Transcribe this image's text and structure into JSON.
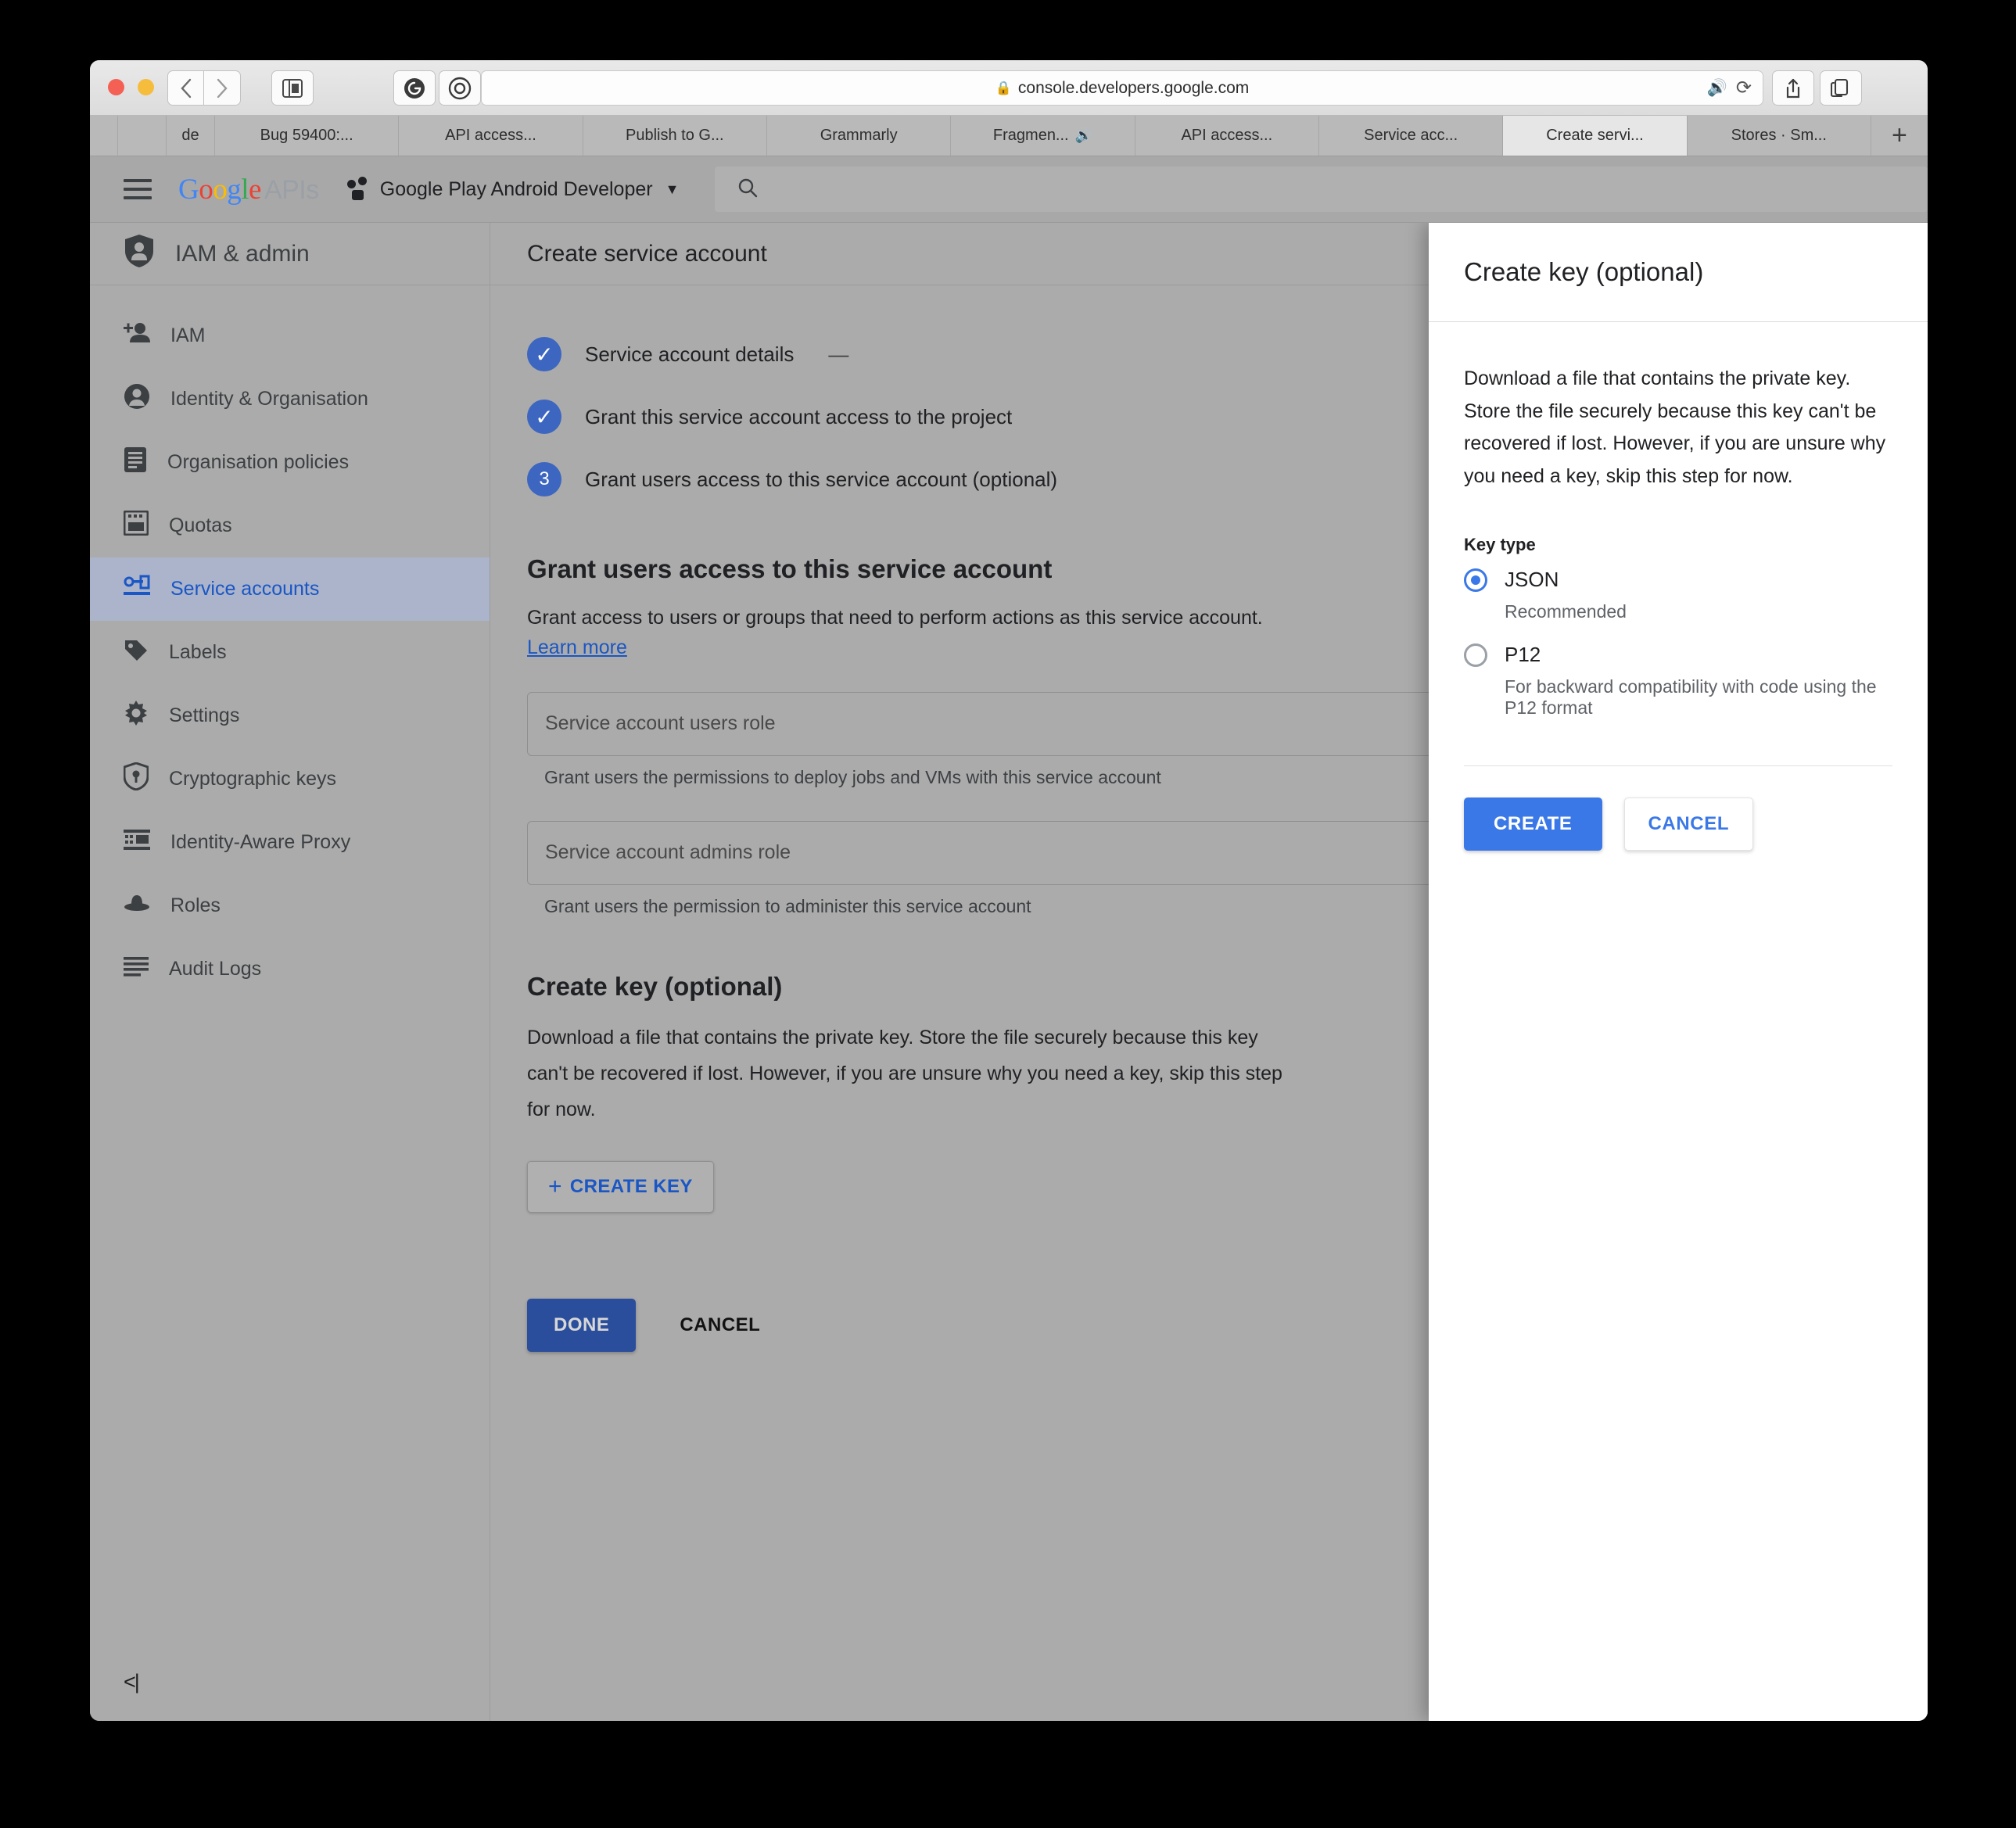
{
  "browser": {
    "url": "console.developers.google.com",
    "lock_icon": "lock-icon",
    "back_icon": "chevron-left-icon",
    "forward_icon": "chevron-right-icon",
    "sidebar_icon": "sidebar-toggle-icon",
    "ext1_icon": "grammarly-icon",
    "ext2_icon": "onepassword-icon",
    "mute_icon": "speaker-icon",
    "reload_icon": "reload-icon",
    "share_icon": "share-icon",
    "tabs_overview_icon": "tab-overview-icon",
    "new_tab_label": "+",
    "tabs": [
      {
        "label": "de",
        "active": false,
        "muted": false,
        "size": "narrow"
      },
      {
        "label": "Bug 59400:...",
        "active": false,
        "muted": false,
        "size": "normal"
      },
      {
        "label": "API access...",
        "active": false,
        "muted": false,
        "size": "normal"
      },
      {
        "label": "Publish to G...",
        "active": false,
        "muted": false,
        "size": "normal"
      },
      {
        "label": "Grammarly",
        "active": false,
        "muted": false,
        "size": "normal"
      },
      {
        "label": "Fragmen...",
        "active": false,
        "muted": true,
        "size": "normal"
      },
      {
        "label": "API access...",
        "active": false,
        "muted": false,
        "size": "normal"
      },
      {
        "label": "Service acc...",
        "active": false,
        "muted": false,
        "size": "normal"
      },
      {
        "label": "Create servi...",
        "active": true,
        "muted": false,
        "size": "normal"
      },
      {
        "label": "Stores · Sm...",
        "active": false,
        "muted": false,
        "size": "normal"
      }
    ]
  },
  "header": {
    "menu_icon": "hamburger-icon",
    "logo_google": "Google",
    "logo_apis": "APIs",
    "project_name": "Google Play Android Developer",
    "project_caret": "▼",
    "search_icon": "search-icon",
    "search_placeholder": ""
  },
  "sidebar": {
    "title": "IAM & admin",
    "title_icon": "shield-person-icon",
    "collapse_icon": "collapse-left-icon",
    "items": [
      {
        "label": "IAM",
        "icon": "person-add-icon",
        "active": false
      },
      {
        "label": "Identity & Organisation",
        "icon": "account-circle-icon",
        "active": false
      },
      {
        "label": "Organisation policies",
        "icon": "document-icon",
        "active": false
      },
      {
        "label": "Quotas",
        "icon": "quota-icon",
        "active": false
      },
      {
        "label": "Service accounts",
        "icon": "key-card-icon",
        "active": true
      },
      {
        "label": "Labels",
        "icon": "label-icon",
        "active": false
      },
      {
        "label": "Settings",
        "icon": "gear-icon",
        "active": false
      },
      {
        "label": "Cryptographic keys",
        "icon": "shield-key-icon",
        "active": false
      },
      {
        "label": "Identity-Aware Proxy",
        "icon": "proxy-icon",
        "active": false
      },
      {
        "label": "Roles",
        "icon": "hat-icon",
        "active": false
      },
      {
        "label": "Audit Logs",
        "icon": "list-icon",
        "active": false
      }
    ]
  },
  "main": {
    "page_title": "Create service account",
    "steps": [
      {
        "marker": "✓",
        "state": "done",
        "label": "Service account details",
        "suffix": "—"
      },
      {
        "marker": "✓",
        "state": "done",
        "label": "Grant this service account access to the project",
        "suffix": ""
      },
      {
        "marker": "3",
        "state": "current",
        "label": "Grant users access to this service account (optional)",
        "suffix": ""
      }
    ],
    "grant_section": {
      "heading": "Grant users access to this service account",
      "description": "Grant access to users or groups that need to perform actions as this service account.",
      "learn_more": "Learn more",
      "users_role_placeholder": "Service account users role",
      "users_role_hint": "Grant users the permissions to deploy jobs and VMs with this service account",
      "admins_role_placeholder": "Service account admins role",
      "admins_role_hint": "Grant users the permission to administer this service account"
    },
    "create_key_section": {
      "heading": "Create key (optional)",
      "paragraph_lines": [
        "Download a file that contains the private key. Store the file securely because this key",
        "can't be recovered if lost. However, if you are unsure why you need a key, skip this step",
        "for now."
      ],
      "create_key_button": "CREATE KEY",
      "create_key_plus": "+"
    },
    "done_button": "DONE",
    "cancel_button": "CANCEL"
  },
  "panel": {
    "title": "Create key (optional)",
    "description": "Download a file that contains the private key. Store the file securely because this key can't be recovered if lost. However, if you are unsure why you need a key, skip this step for now.",
    "key_type_label": "Key type",
    "options": [
      {
        "label": "JSON",
        "sub": "Recommended",
        "selected": true
      },
      {
        "label": "P12",
        "sub": "For backward compatibility with code using the P12 format",
        "selected": false
      }
    ],
    "create_button": "CREATE",
    "cancel_button": "CANCEL"
  },
  "colors": {
    "accent_blue": "#3b78e7",
    "link_blue": "#1a56c4",
    "done_blue": "#2a4e9b",
    "overlay_grey": "#ababab"
  }
}
